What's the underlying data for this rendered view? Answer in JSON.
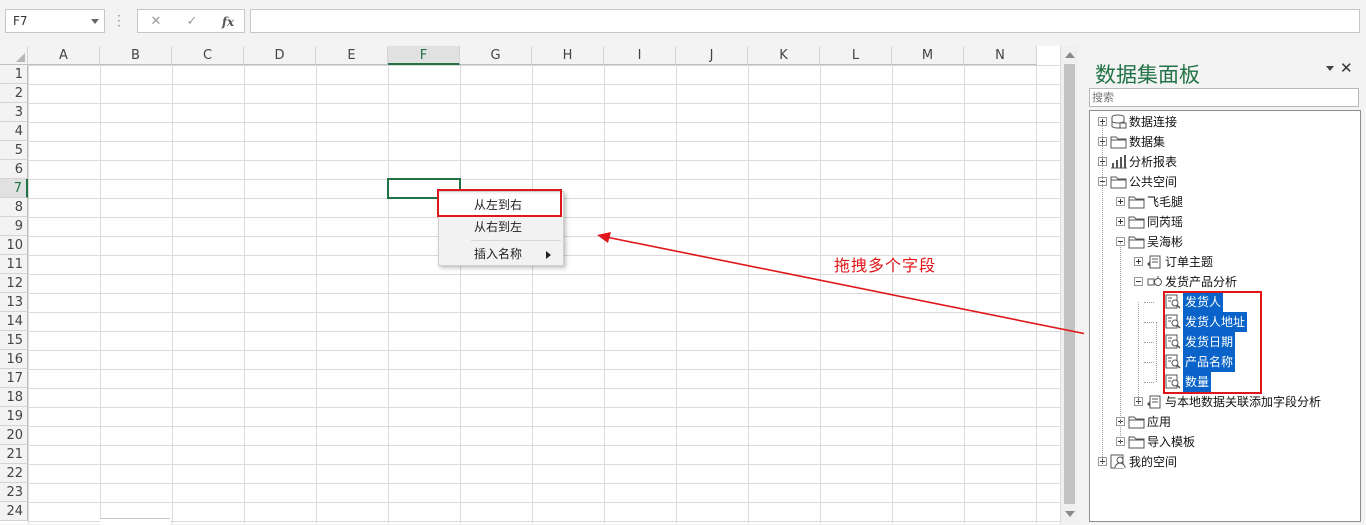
{
  "formula_bar": {
    "name_box": "F7",
    "cancel_icon": "✕",
    "confirm_icon": "✓",
    "fx_label": "fx",
    "formula_value": ""
  },
  "sheet": {
    "columns": [
      "A",
      "B",
      "C",
      "D",
      "E",
      "F",
      "G",
      "H",
      "I",
      "J",
      "K",
      "L",
      "M",
      "N"
    ],
    "rows": [
      "1",
      "2",
      "3",
      "4",
      "5",
      "6",
      "7",
      "8",
      "9",
      "10",
      "11",
      "12",
      "13",
      "14",
      "15",
      "16",
      "17",
      "18",
      "19",
      "20",
      "21",
      "22",
      "23",
      "24"
    ],
    "selected_column": "F",
    "selected_row": "7"
  },
  "context_menu": {
    "items": [
      "从左到右",
      "从右到左",
      "插入名称"
    ]
  },
  "annotation": {
    "label": "拖拽多个字段",
    "color": "#e0161a"
  },
  "panel": {
    "title": "数据集面板",
    "close_label": "✕",
    "search_placeholder": "搜索",
    "tree": [
      {
        "label": "数据连接",
        "icon": "database-icon",
        "expander": "plus"
      },
      {
        "label": "数据集",
        "icon": "folder-icon",
        "expander": "plus"
      },
      {
        "label": "分析报表",
        "icon": "report-icon",
        "expander": "plus"
      },
      {
        "label": "公共空间",
        "icon": "folder-icon",
        "expander": "minus"
      },
      {
        "label": "飞毛腿",
        "icon": "folder-icon",
        "expander": "plus"
      },
      {
        "label": "同芮瑶",
        "icon": "folder-icon",
        "expander": "plus"
      },
      {
        "label": "吴海彬",
        "icon": "folder-icon",
        "expander": "minus"
      },
      {
        "label": "订单主题",
        "icon": "topic-icon",
        "expander": "plus"
      },
      {
        "label": "发货产品分析",
        "icon": "dataset-icon",
        "expander": "minus"
      },
      {
        "label": "发货人",
        "icon": "field-icon",
        "selected": true
      },
      {
        "label": "发货人地址",
        "icon": "field-icon",
        "selected": true
      },
      {
        "label": "发货日期",
        "icon": "field-icon",
        "selected": true
      },
      {
        "label": "产品名称",
        "icon": "field-icon",
        "selected": true
      },
      {
        "label": "数量",
        "icon": "field-icon",
        "selected": true
      },
      {
        "label": "与本地数据关联添加字段分析",
        "icon": "topic-icon",
        "expander": "plus"
      },
      {
        "label": "应用",
        "icon": "folder-icon",
        "expander": "plus"
      },
      {
        "label": "导入模板",
        "icon": "folder-icon",
        "expander": "plus"
      },
      {
        "label": "我的空间",
        "icon": "user-space-icon",
        "expander": "plus"
      }
    ]
  },
  "colors": {
    "accent": "#217346",
    "selection": "#0a63c8",
    "highlight_border": "#e0161a"
  }
}
